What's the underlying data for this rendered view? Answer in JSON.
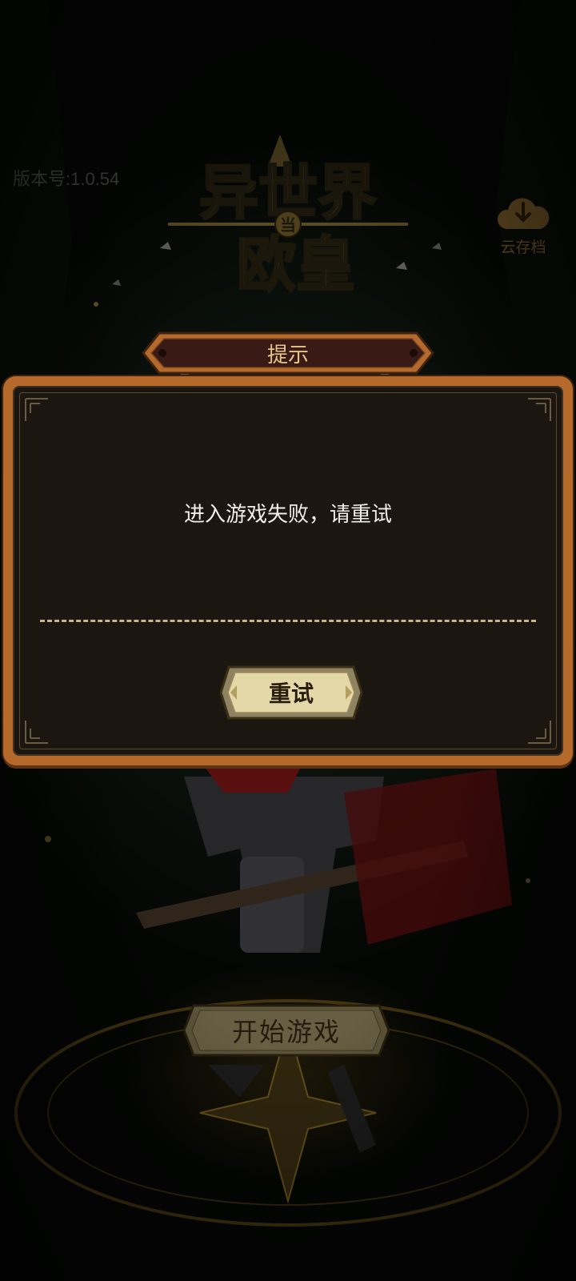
{
  "version": {
    "label": "版本号:1.0.54"
  },
  "logo": {
    "line1": "异世界",
    "badge": "当",
    "line2": "欧皇"
  },
  "cloud_save": {
    "label": "云存档",
    "icon": "cloud-download-icon"
  },
  "dialog": {
    "title": "提示",
    "message": "进入游戏失败，请重试",
    "retry_label": "重试"
  },
  "start_button": {
    "label": "开始游戏"
  },
  "colors": {
    "panel_border": "#b56a2c",
    "panel_bg": "#1b1710",
    "title_text": "#e6c58a",
    "button_face": "#e4d7a8"
  }
}
